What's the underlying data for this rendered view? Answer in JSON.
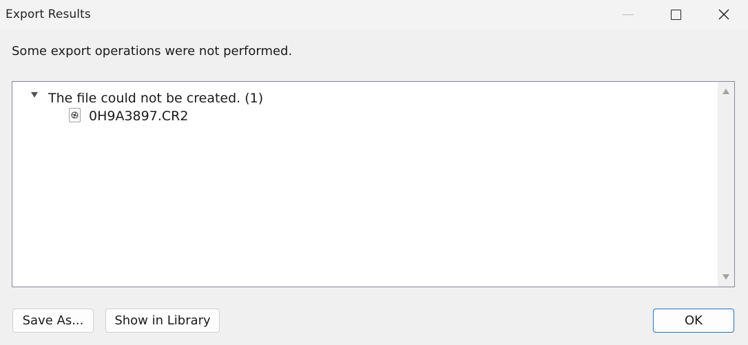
{
  "window": {
    "title": "Export Results",
    "controls": {
      "minimize": "minimize-icon",
      "maximize": "maximize-icon",
      "close": "close-icon"
    }
  },
  "message": "Some export operations were not performed.",
  "tree": {
    "groups": [
      {
        "label": "The file could not be created. (1)",
        "expanded": true,
        "items": [
          {
            "name": "0H9A3897.CR2",
            "icon": "raw-file-icon"
          }
        ]
      }
    ]
  },
  "buttons": {
    "save_as": "Save As...",
    "show_in_library": "Show in Library",
    "ok": "OK"
  },
  "colors": {
    "accent": "#1f6fc5",
    "background": "#f0f0f0",
    "panel": "#ffffff"
  }
}
